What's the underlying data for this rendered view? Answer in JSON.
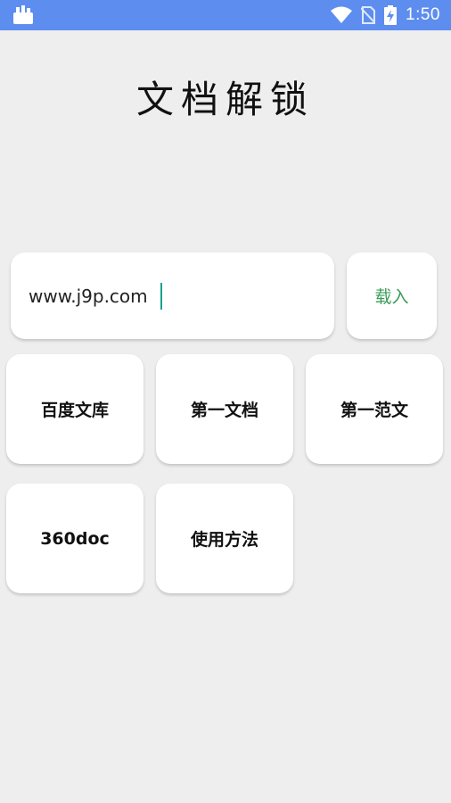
{
  "status_bar": {
    "time": "1:50",
    "icons": [
      "app-notification-icon",
      "wifi-icon",
      "no-sim-icon",
      "battery-charging-icon"
    ],
    "background": "#5d8def"
  },
  "app": {
    "title": "文档解锁"
  },
  "url_input": {
    "value": "www.j9p.com"
  },
  "load_button": {
    "label": "载入",
    "color": "#3a9c5a"
  },
  "shortcuts": [
    {
      "label": "百度文库"
    },
    {
      "label": "第一文档"
    },
    {
      "label": "第一范文"
    },
    {
      "label": "360doc"
    },
    {
      "label": "使用方法"
    }
  ]
}
